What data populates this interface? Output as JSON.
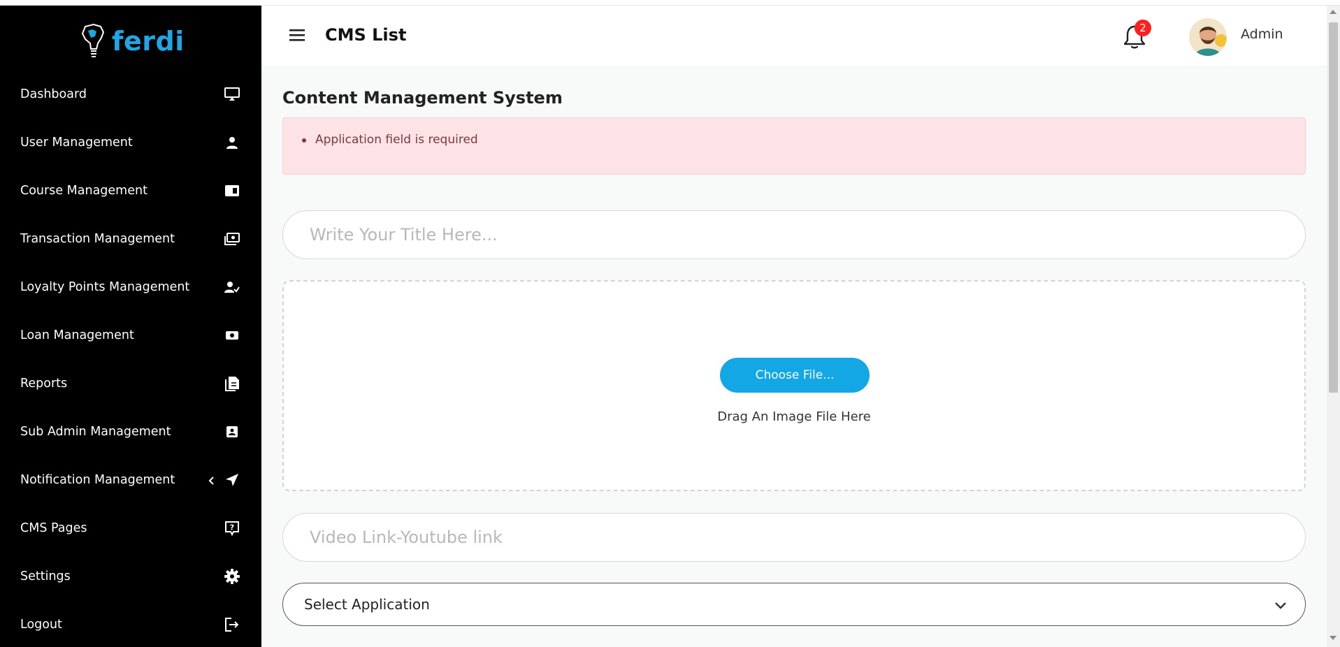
{
  "brand": {
    "name": "ferdi",
    "logo_icon": "africa-bulb-icon",
    "accent_color": "#1ea7e6"
  },
  "sidebar": {
    "items": [
      {
        "label": "Dashboard",
        "icon": "monitor-icon"
      },
      {
        "label": "User Management",
        "icon": "user-icon"
      },
      {
        "label": "Course Management",
        "icon": "book-icon"
      },
      {
        "label": "Transaction Management",
        "icon": "money-icon"
      },
      {
        "label": "Loyalty Points Management",
        "icon": "user-check-icon"
      },
      {
        "label": "Loan Management",
        "icon": "cash-icon"
      },
      {
        "label": "Reports",
        "icon": "file-icon"
      },
      {
        "label": "Sub Admin Management",
        "icon": "id-card-icon"
      },
      {
        "label": "Notification Management",
        "icon": "paper-plane-icon",
        "has_submenu": true
      },
      {
        "label": "CMS Pages",
        "icon": "question-box-icon"
      },
      {
        "label": "Settings",
        "icon": "gear-icon"
      },
      {
        "label": "Logout",
        "icon": "logout-icon"
      }
    ]
  },
  "header": {
    "title": "CMS List",
    "notification_count": "2",
    "user_name": "Admin"
  },
  "main": {
    "section_title": "Content Management System",
    "alert": {
      "message": "Application field is required",
      "color": "#fde3e6"
    },
    "title_input": {
      "placeholder": "Write Your Title Here...",
      "value": ""
    },
    "upload": {
      "button_label": "Choose File...",
      "hint": "Drag An Image File Here",
      "button_color": "#13a7e6"
    },
    "video_input": {
      "placeholder": "Video Link-Youtube link",
      "value": ""
    },
    "application_select": {
      "selected": "Select Application"
    }
  }
}
